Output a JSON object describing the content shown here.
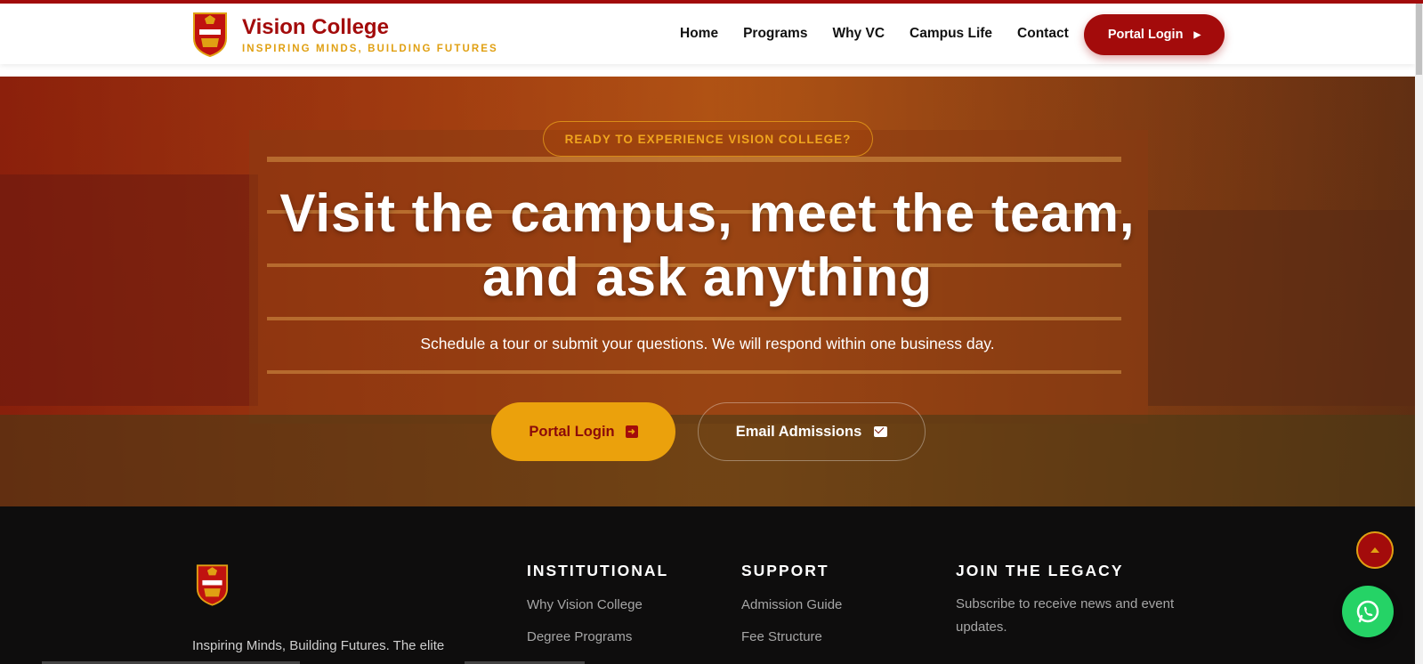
{
  "header": {
    "brand_name": "Vision College",
    "brand_tagline": "INSPIRING MINDS, BUILDING FUTURES",
    "crest_icon": "college-crest-icon",
    "nav": [
      {
        "label": "Home"
      },
      {
        "label": "Programs"
      },
      {
        "label": "Why VC"
      },
      {
        "label": "Campus Life"
      },
      {
        "label": "Contact"
      }
    ],
    "portal_button": "Portal Login"
  },
  "hero": {
    "eyebrow": "READY TO EXPERIENCE VISION COLLEGE?",
    "title": "Visit the campus, meet the team, and ask anything",
    "subtitle": "Schedule a tour or submit your questions. We will respond within one business day.",
    "primary_button": "Portal Login",
    "secondary_button": "Email Admissions"
  },
  "footer": {
    "about_text": "Inspiring Minds, Building Futures. The elite",
    "columns": [
      {
        "title": "INSTITUTIONAL",
        "links": [
          "Why Vision College",
          "Degree Programs"
        ]
      },
      {
        "title": "SUPPORT",
        "links": [
          "Admission Guide",
          "Fee Structure"
        ]
      },
      {
        "title": "JOIN THE LEGACY",
        "text": "Subscribe to receive news and event updates."
      }
    ]
  },
  "floating": {
    "back_to_top_icon": "arrow-up-icon",
    "chat_icon": "whatsapp-icon"
  },
  "colors": {
    "brand_red": "#a30b0b",
    "brand_gold": "#e0a013",
    "footer_bg": "#0e0d0d",
    "whatsapp_green": "#25d366"
  }
}
